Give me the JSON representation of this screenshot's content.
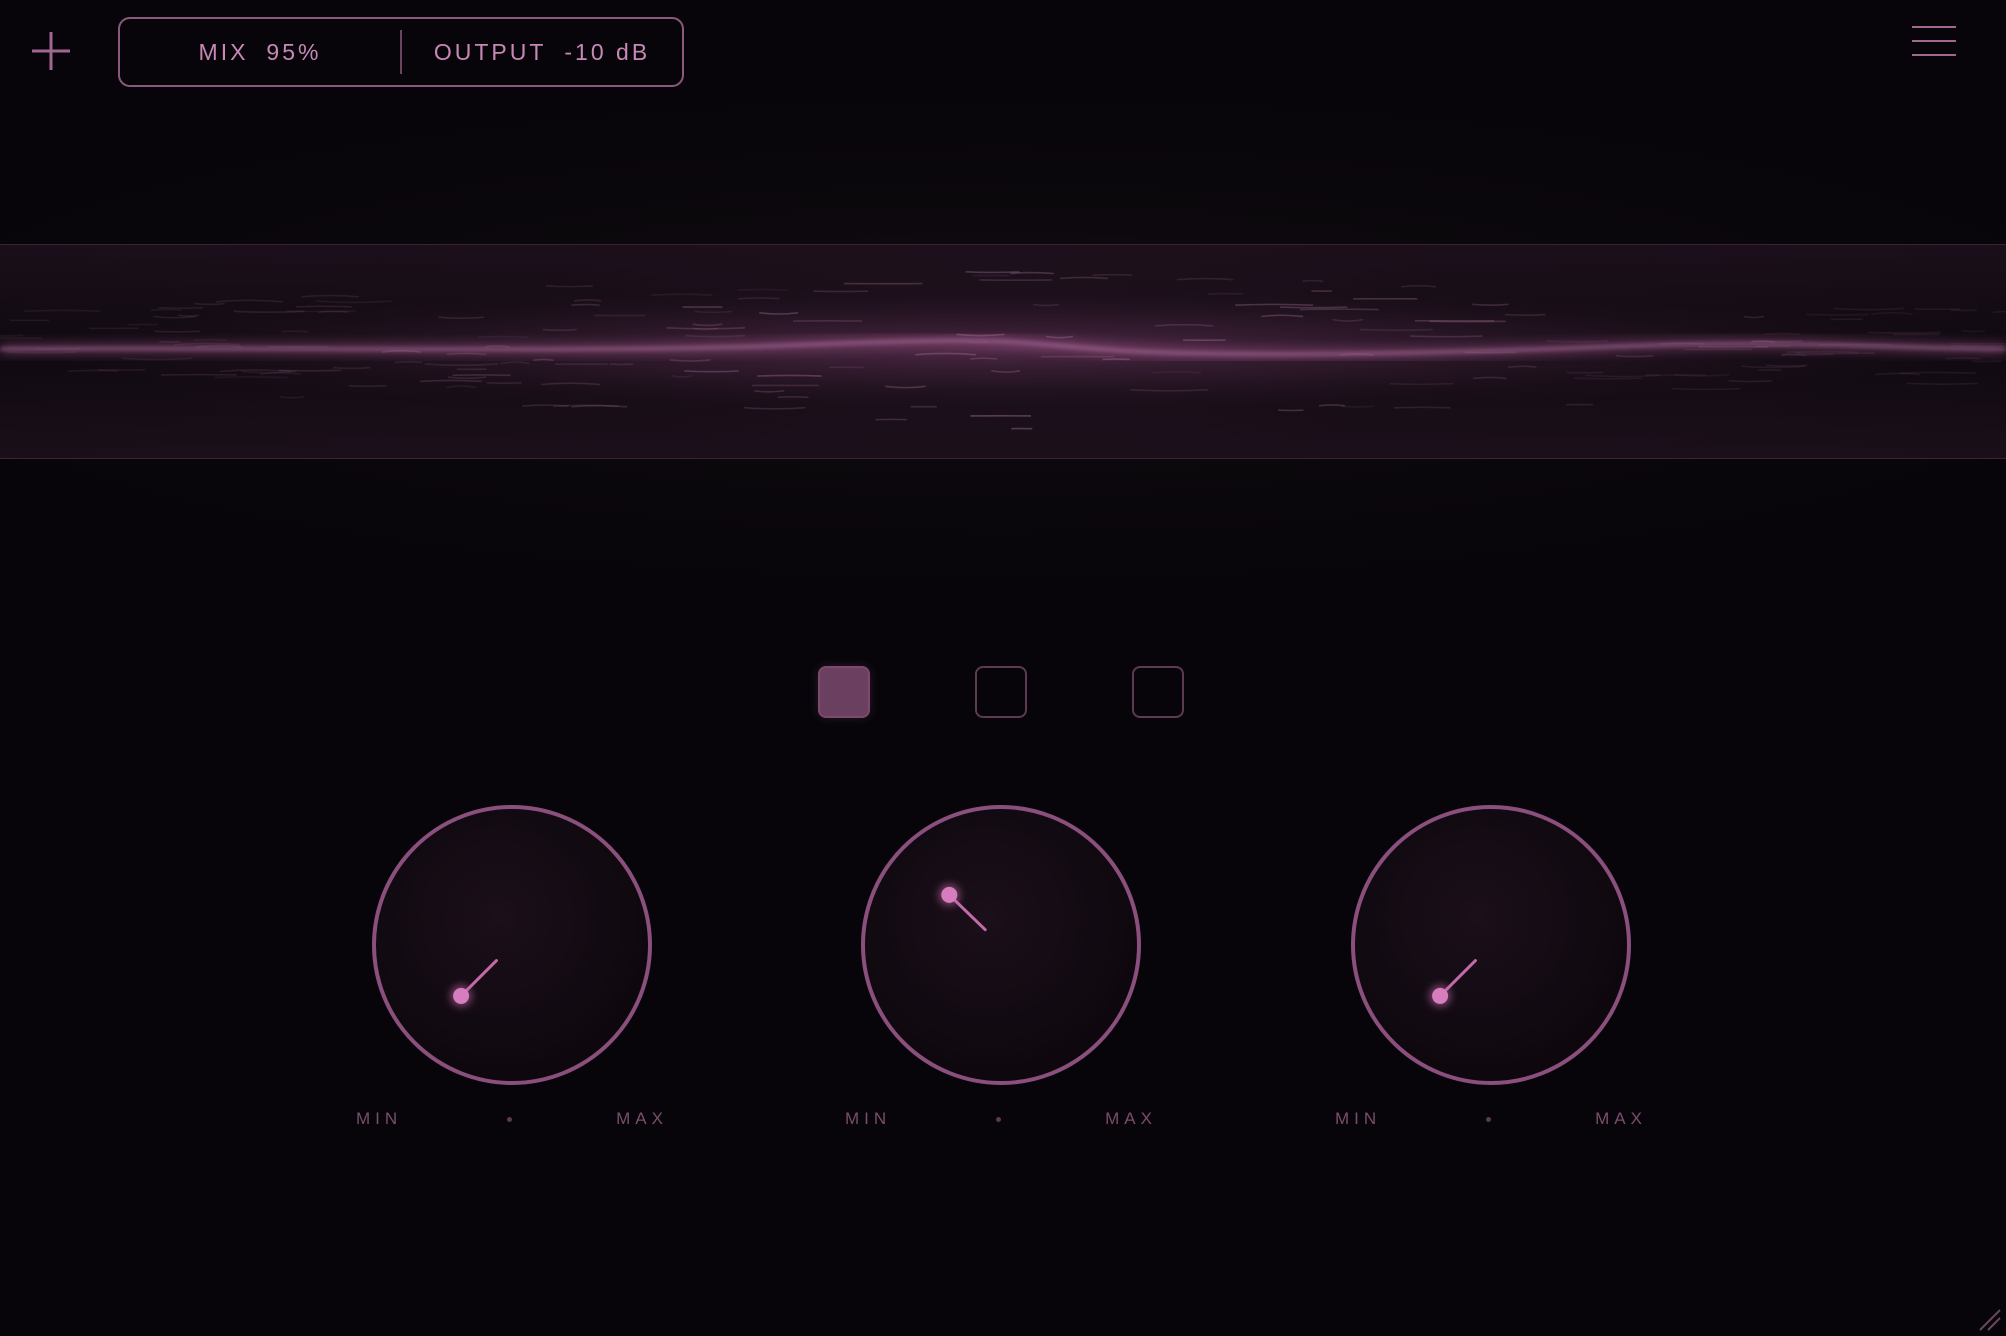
{
  "colors": {
    "accent": "#c36aa9",
    "accent_dim": "#8a5a7c",
    "background": "#07050a",
    "text": "#c788b6",
    "scale_text": "#7a4d6d"
  },
  "toolbar": {
    "add_icon": "plus-icon",
    "menu_icon": "hamburger-menu-icon"
  },
  "status_pill": {
    "mix_label": "MIX",
    "mix_value": "95%",
    "output_label": "OUTPUT",
    "output_value": "-10 dB"
  },
  "modes": {
    "count": 3,
    "active_index": 0
  },
  "knobs": [
    {
      "min_label": "MIN",
      "max_label": "MAX",
      "level": 0.0
    },
    {
      "min_label": "MIN",
      "max_label": "MAX",
      "level": 0.33
    },
    {
      "min_label": "MIN",
      "max_label": "MAX",
      "level": 0.0
    }
  ]
}
